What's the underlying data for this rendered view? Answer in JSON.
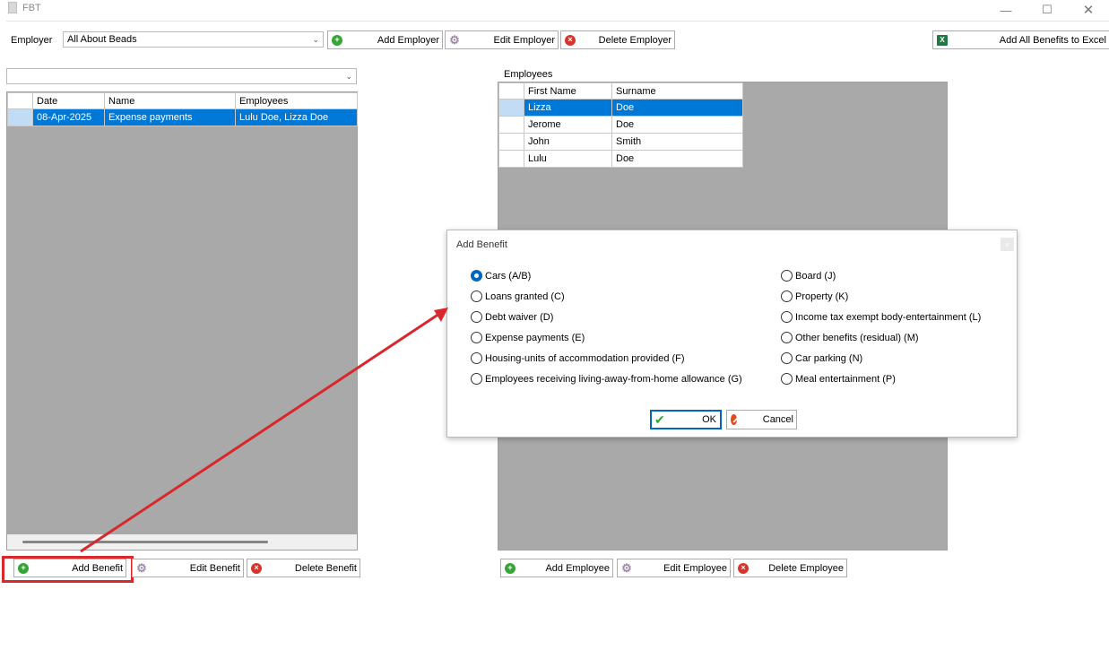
{
  "window": {
    "title": "FBT",
    "controls": [
      "minimize-icon",
      "maximize-icon",
      "close-icon"
    ]
  },
  "toolbar": {
    "employer_label": "Employer",
    "employer_value": "All About Beads",
    "add_employer": "Add Employer",
    "edit_employer": "Edit Employer",
    "delete_employer": "Delete Employer",
    "export": "Add All Benefits to Excel"
  },
  "benefits": {
    "filter_value": "",
    "columns": [
      "Date",
      "Name",
      "Employees"
    ],
    "rows": [
      {
        "date": "08-Apr-2025",
        "name": "Expense payments",
        "employees": "Lulu Doe, Lizza Doe",
        "selected": true
      }
    ],
    "add": "Add Benefit",
    "edit": "Edit Benefit",
    "delete": "Delete Benefit"
  },
  "employees": {
    "label": "Employees",
    "columns": [
      "First Name",
      "Surname"
    ],
    "rows": [
      {
        "first": "Lizza",
        "last": "Doe",
        "selected": true
      },
      {
        "first": "Jerome",
        "last": "Doe"
      },
      {
        "first": "John",
        "last": "Smith"
      },
      {
        "first": "Lulu",
        "last": "Doe"
      }
    ],
    "add": "Add Employee",
    "edit": "Edit Employee",
    "delete": "Delete Employee"
  },
  "dialog": {
    "title": "Add Benefit",
    "left_options": [
      "Cars (A/B)",
      "Loans granted (C)",
      "Debt waiver (D)",
      "Expense payments (E)",
      "Housing-units of accommodation provided (F)",
      "Employees receiving living-away-from-home allowance (G)"
    ],
    "right_options": [
      "Board (J)",
      "Property (K)",
      "Income tax exempt body-entertainment (L)",
      "Other benefits (residual) (M)",
      "Car parking (N)",
      "Meal entertainment (P)"
    ],
    "selected": "Cars (A/B)",
    "ok": "OK",
    "cancel": "Cancel"
  },
  "colors": {
    "selection": "#0078d7",
    "grid_background": "#a9a9a9",
    "annotation": "#d9282c"
  }
}
